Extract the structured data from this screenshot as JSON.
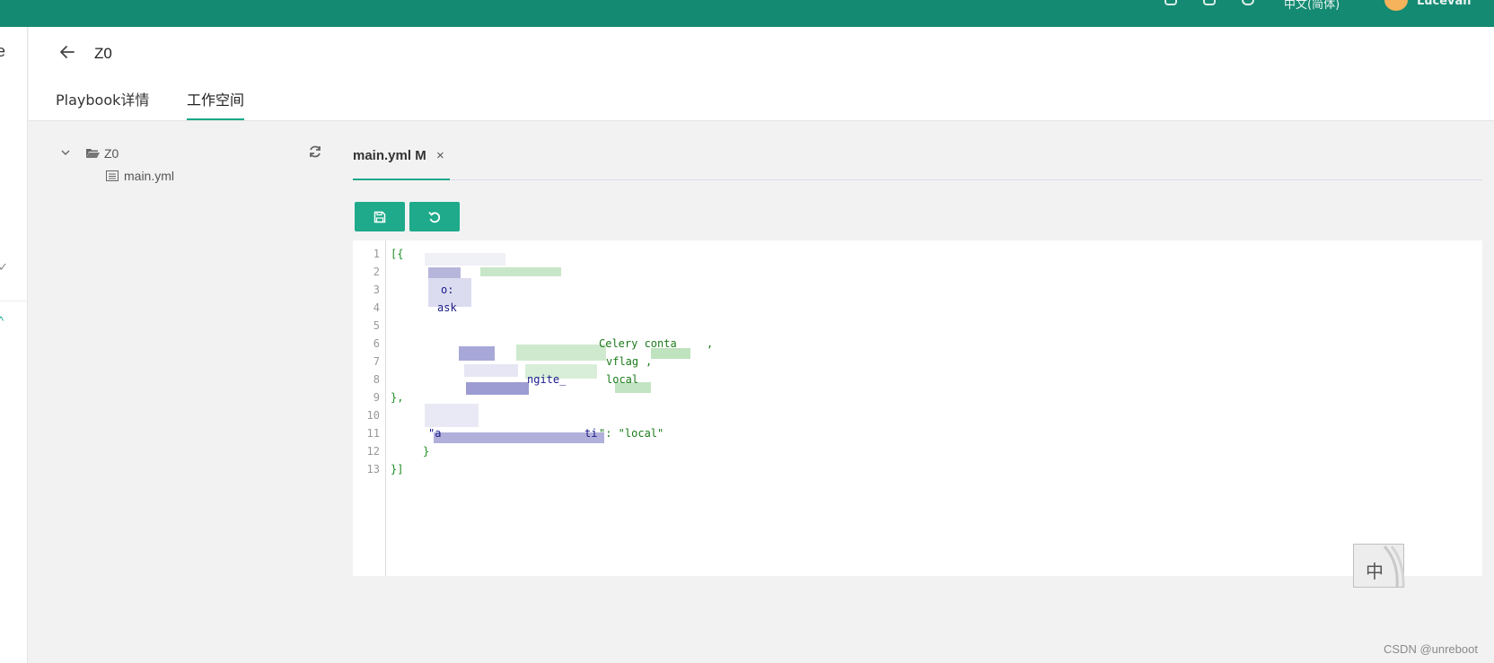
{
  "topbar": {
    "text_partial": "中文(简体)",
    "user_partial": "Lucevan"
  },
  "header": {
    "page_title": "Z0",
    "tabs": [
      {
        "label": "Playbook详情"
      },
      {
        "label": "工作空间"
      }
    ]
  },
  "file_tree": {
    "folder": "Z0",
    "files": [
      "main.yml"
    ]
  },
  "editor": {
    "tab_label": "main.yml M",
    "close_glyph": "×",
    "line_numbers": [
      "1",
      "2",
      "3",
      "4",
      "5",
      "6",
      "7",
      "8",
      "9",
      "10",
      "11",
      "12",
      "13"
    ],
    "code_fragments": {
      "line1": "[{",
      "line3": "o:",
      "line4": "ask",
      "line6": "Celery conta",
      "line6_end": ",",
      "line7": "vflag",
      "line7_end": ",",
      "line8a": "ngite_",
      "line8b": "local",
      "line9": "},",
      "line11a": "\"a",
      "line11b": "ti",
      "line11c": "\": \"local\"",
      "line12": "}",
      "line13": "}]"
    }
  },
  "ime": {
    "label": "中"
  },
  "watermark": "CSDN @unreboot",
  "colors": {
    "primary": "#1eaa8b",
    "topbar": "#158a72"
  },
  "icons": [
    "back-arrow-icon",
    "chevron-down-icon",
    "folder-open-icon",
    "file-icon",
    "refresh-icon",
    "save-icon",
    "undo-icon"
  ]
}
